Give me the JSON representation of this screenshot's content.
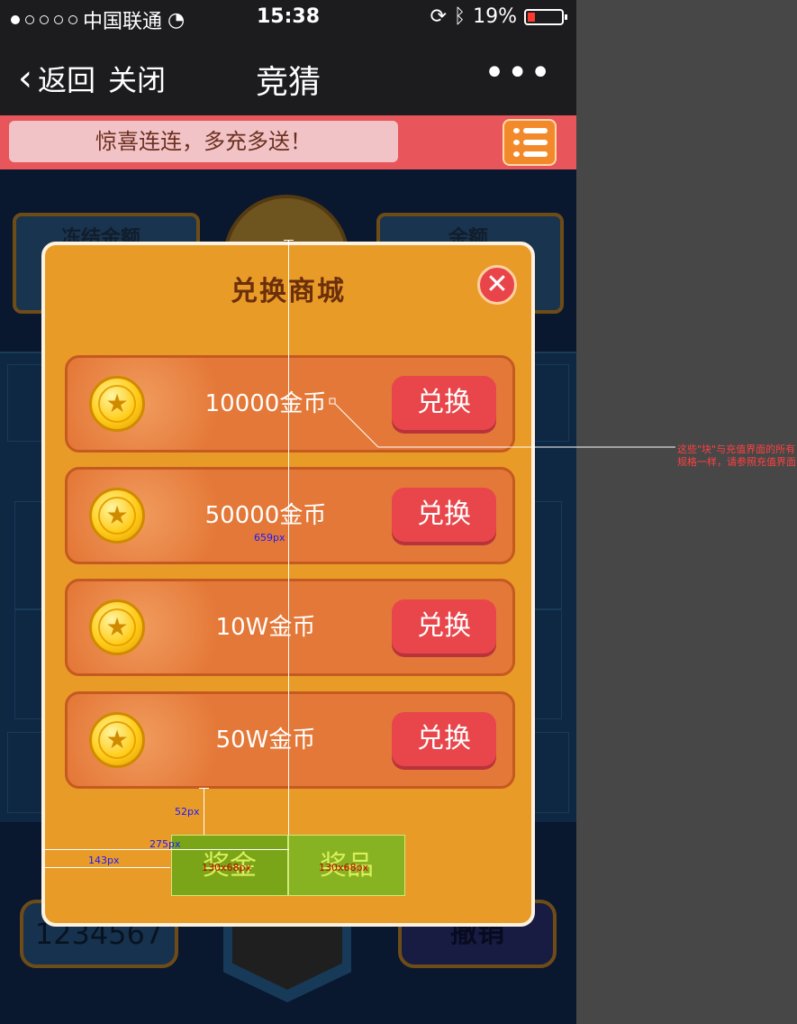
{
  "status": {
    "carrier": "中国联通",
    "time": "15:38",
    "battery": "19%"
  },
  "nav": {
    "back": "返回",
    "close": "关闭",
    "title": "竞猜",
    "more": "•••"
  },
  "banner": {
    "message": "惊喜连连，多充多送！"
  },
  "background": {
    "frozen_label": "冻结金额",
    "balance_label": "余额",
    "input_value": "1234567",
    "cancel_label": "撤销"
  },
  "modal": {
    "title": "兑换商城",
    "items": [
      {
        "amount": "10000金币",
        "button": "兑换"
      },
      {
        "amount": "50000金币",
        "button": "兑换"
      },
      {
        "amount": "10W金币",
        "button": "兑换"
      },
      {
        "amount": "50W金币",
        "button": "兑换"
      }
    ],
    "tabs": [
      {
        "label": "奖金",
        "dim": "130x68px"
      },
      {
        "label": "奖品",
        "dim": "130x68px"
      }
    ]
  },
  "annotations": {
    "height_659": "659px",
    "gap_52": "52px",
    "w_275": "275px",
    "w_143": "143px",
    "note": "这些\"块\"与充值界面的所有规格一样，请参照充值界面"
  },
  "colors": {
    "modal_bg": "#e99b28",
    "row_bg": "#e47838",
    "exchange_btn": "#e8464b",
    "tab_bg": "#7aa519"
  }
}
